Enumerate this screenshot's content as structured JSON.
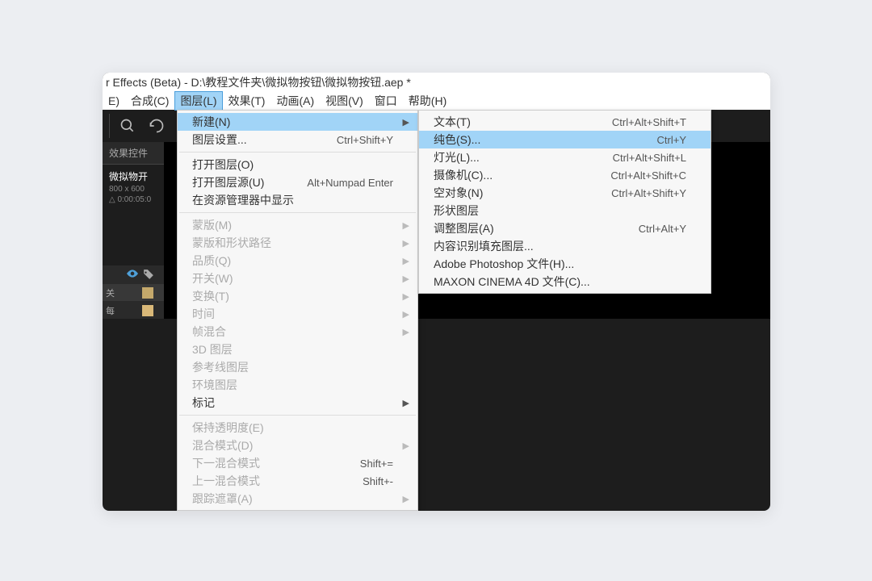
{
  "title": "r Effects (Beta) - D:\\教程文件夹\\微拟物按钮\\微拟物按钮.aep *",
  "menubar": {
    "items": [
      {
        "label": "E)"
      },
      {
        "label": "合成(C)"
      },
      {
        "label": "图层(L)",
        "active": true
      },
      {
        "label": "效果(T)"
      },
      {
        "label": "动画(A)"
      },
      {
        "label": "视图(V)"
      },
      {
        "label": "窗口"
      },
      {
        "label": "帮助(H)"
      }
    ]
  },
  "leftPanel": {
    "header": "效果控件",
    "compName": "微拟物开",
    "compDim": "800 x 600",
    "compDelta": "△ 0:00:05:0"
  },
  "layerPanel": {
    "row1": "关",
    "row2": "每"
  },
  "layerMenu": {
    "items": [
      {
        "label": "新建(N)",
        "submenu": true,
        "highlighted": true
      },
      {
        "label": "图层设置...",
        "shortcut": "Ctrl+Shift+Y"
      },
      {
        "sep": true
      },
      {
        "label": "打开图层(O)"
      },
      {
        "label": "打开图层源(U)",
        "shortcut": "Alt+Numpad Enter"
      },
      {
        "label": "在资源管理器中显示"
      },
      {
        "sep": true
      },
      {
        "label": "蒙版(M)",
        "submenu": true,
        "disabled": true
      },
      {
        "label": "蒙版和形状路径",
        "submenu": true,
        "disabled": true
      },
      {
        "label": "品质(Q)",
        "submenu": true,
        "disabled": true
      },
      {
        "label": "开关(W)",
        "submenu": true,
        "disabled": true
      },
      {
        "label": "变换(T)",
        "submenu": true,
        "disabled": true
      },
      {
        "label": "时间",
        "submenu": true,
        "disabled": true
      },
      {
        "label": "帧混合",
        "submenu": true,
        "disabled": true
      },
      {
        "label": "3D 图层",
        "disabled": true
      },
      {
        "label": "参考线图层",
        "disabled": true
      },
      {
        "label": "环境图层",
        "disabled": true
      },
      {
        "label": "标记",
        "submenu": true
      },
      {
        "sep": true
      },
      {
        "label": "保持透明度(E)",
        "disabled": true
      },
      {
        "label": "混合模式(D)",
        "submenu": true,
        "disabled": true
      },
      {
        "label": "下一混合模式",
        "shortcut": "Shift+=",
        "disabled": true
      },
      {
        "label": "上一混合模式",
        "shortcut": "Shift+-",
        "disabled": true
      },
      {
        "label": "跟踪遮罩(A)",
        "submenu": true,
        "disabled": true
      }
    ]
  },
  "newSubmenu": {
    "items": [
      {
        "label": "文本(T)",
        "shortcut": "Ctrl+Alt+Shift+T"
      },
      {
        "label": "纯色(S)...",
        "shortcut": "Ctrl+Y",
        "highlighted": true
      },
      {
        "label": "灯光(L)...",
        "shortcut": "Ctrl+Alt+Shift+L"
      },
      {
        "label": "摄像机(C)...",
        "shortcut": "Ctrl+Alt+Shift+C"
      },
      {
        "label": "空对象(N)",
        "shortcut": "Ctrl+Alt+Shift+Y"
      },
      {
        "label": "形状图层"
      },
      {
        "label": "调整图层(A)",
        "shortcut": "Ctrl+Alt+Y"
      },
      {
        "label": "内容识别填充图层..."
      },
      {
        "label": "Adobe Photoshop 文件(H)..."
      },
      {
        "label": "MAXON CINEMA 4D 文件(C)..."
      }
    ]
  }
}
